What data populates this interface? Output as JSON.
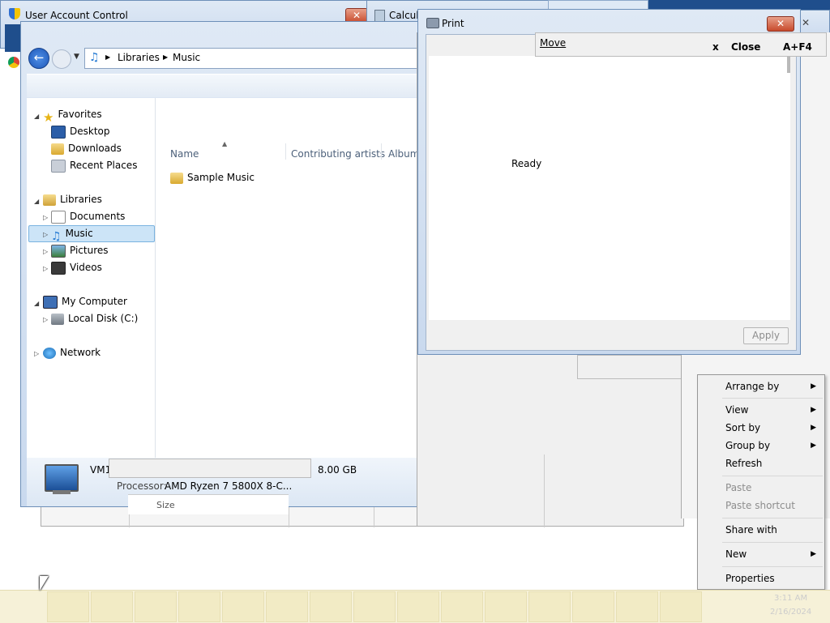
{
  "uac": {
    "title": "User Account Control"
  },
  "calc": {
    "title": "Calcul"
  },
  "explorer": {
    "breadcrumb": [
      "Libraries",
      "Music"
    ],
    "nav": {
      "favorites": "Favorites",
      "desktop": "Desktop",
      "downloads": "Downloads",
      "recent": "Recent Places",
      "libraries": "Libraries",
      "documents": "Documents",
      "music": "Music",
      "pictures": "Pictures",
      "videos": "Videos",
      "computer": "My Computer",
      "localdisk": "Local Disk (C:)",
      "network": "Network"
    },
    "columns": {
      "name": "Name",
      "artists": "Contributing artists",
      "album": "Album"
    },
    "items": [
      {
        "name": "Sample Music"
      }
    ],
    "details": {
      "computer_name": "VM1",
      "memory": "8.00 GB",
      "processor_label": "Processor:",
      "processor_value": "AMD Ryzen 7 5800X 8-C..."
    },
    "partial_header": "Size"
  },
  "print_dialog": {
    "title": "Print",
    "status": "Ready",
    "apply": "Apply",
    "move": "Move",
    "close": "Close",
    "close_x": "x",
    "close_shortcut": "A+F4"
  },
  "context_menu": {
    "arrange_by": "Arrange by",
    "view": "View",
    "sort_by": "Sort by",
    "group_by": "Group by",
    "refresh": "Refresh",
    "paste": "Paste",
    "paste_shortcut": "Paste shortcut",
    "share_with": "Share with",
    "new": "New",
    "properties": "Properties"
  },
  "taskbar": {
    "time": "3:11 AM",
    "date": "2/16/2024"
  },
  "colors": {
    "accent": "#3a7bd5",
    "selection": "#cce4f7",
    "close_red": "#c74a2c"
  }
}
